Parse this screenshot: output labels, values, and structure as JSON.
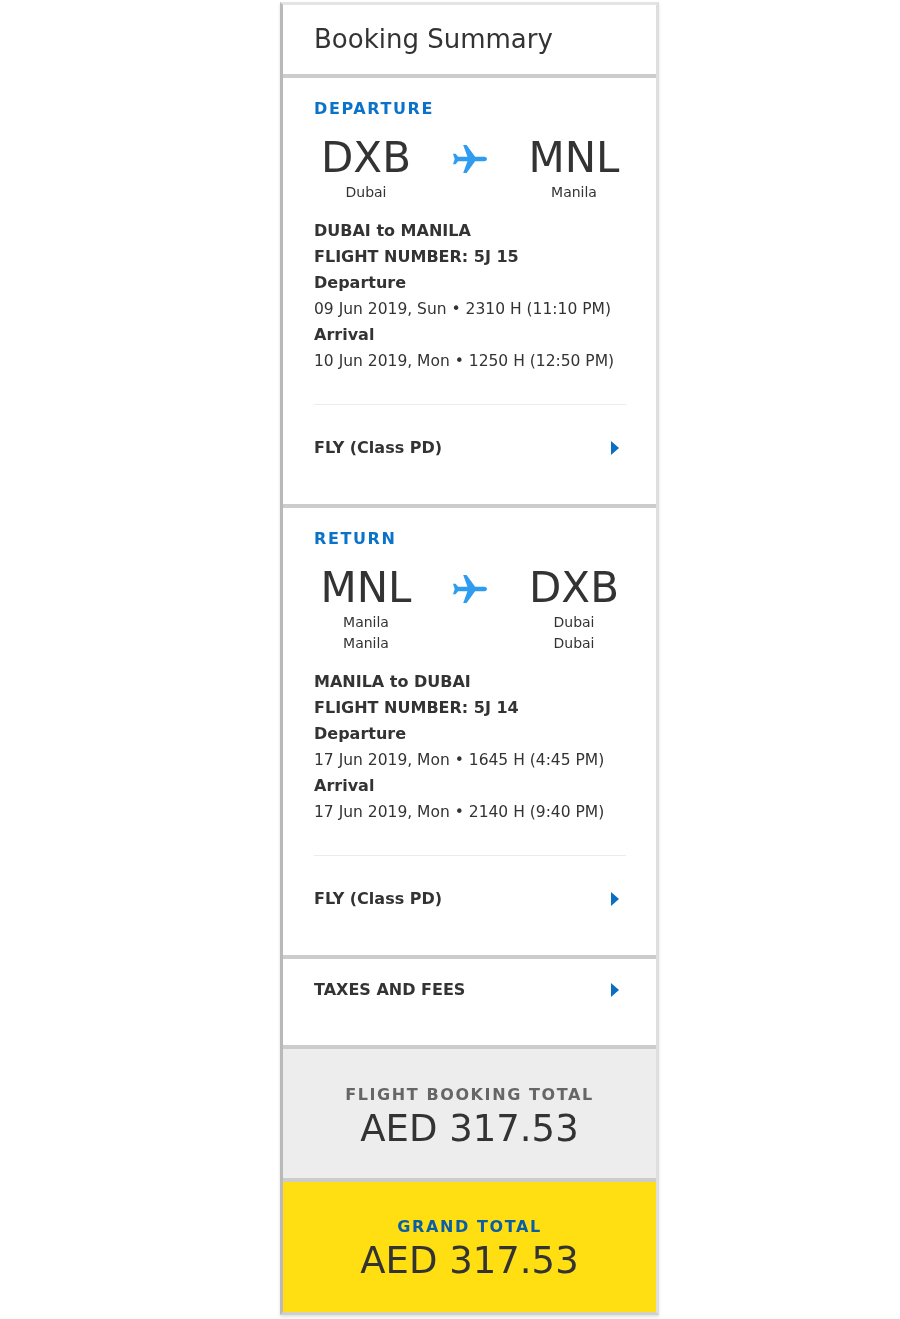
{
  "title": "Booking Summary",
  "flights": [
    {
      "label": "DEPARTURE",
      "origin": {
        "code": "DXB",
        "city_lines": [
          "Dubai"
        ]
      },
      "destination": {
        "code": "MNL",
        "city_lines": [
          "Manila"
        ]
      },
      "route": "DUBAI to MANILA",
      "flight_number": "FLIGHT NUMBER: 5J 15",
      "departure": {
        "label": "Departure",
        "time": "09 Jun 2019, Sun • 2310 H (11:10 PM)"
      },
      "arrival": {
        "label": "Arrival",
        "time": "10 Jun 2019, Mon • 1250 H (12:50 PM)"
      },
      "fare": {
        "label": "FLY (Class PD)",
        "expanded": false
      }
    },
    {
      "label": "RETURN",
      "origin": {
        "code": "MNL",
        "city_lines": [
          "Manila",
          "Manila"
        ]
      },
      "destination": {
        "code": "DXB",
        "city_lines": [
          "Dubai",
          "Dubai"
        ]
      },
      "route": "MANILA to DUBAI",
      "flight_number": "FLIGHT NUMBER: 5J 14",
      "departure": {
        "label": "Departure",
        "time": "17 Jun 2019, Mon • 1645 H (4:45 PM)"
      },
      "arrival": {
        "label": "Arrival",
        "time": "17 Jun 2019, Mon • 2140 H (9:40 PM)"
      },
      "fare": {
        "label": "FLY (Class PD)",
        "expanded": false
      }
    }
  ],
  "taxes_and_fees": {
    "label": "TAXES AND FEES",
    "expanded": false
  },
  "flight_booking_total": {
    "label": "FLIGHT BOOKING TOTAL",
    "amount": "AED 317.53"
  },
  "grand_total": {
    "label": "GRAND TOTAL",
    "amount": "AED 317.53"
  }
}
